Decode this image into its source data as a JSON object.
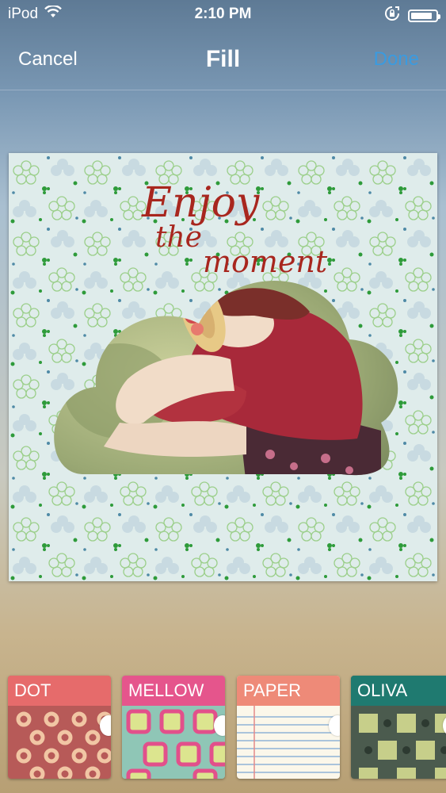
{
  "status_bar": {
    "carrier": "iPod",
    "time": "2:10 PM",
    "battery_level": 0.85
  },
  "nav": {
    "cancel_label": "Cancel",
    "title": "Fill",
    "done_label": "Done"
  },
  "canvas": {
    "text_line1": "Enjoy",
    "text_line2": "the",
    "text_line3": "moment"
  },
  "patterns": [
    {
      "name": "DOT",
      "header_color": "#e66b6b"
    },
    {
      "name": "MELLOW",
      "header_color": "#e5558c"
    },
    {
      "name": "PAPER",
      "header_color": "#ee8a78"
    },
    {
      "name": "OLIVA",
      "header_color": "#1f7a70"
    }
  ],
  "colors": {
    "accent": "#3a9be0",
    "frame_text": "#a8261e"
  }
}
